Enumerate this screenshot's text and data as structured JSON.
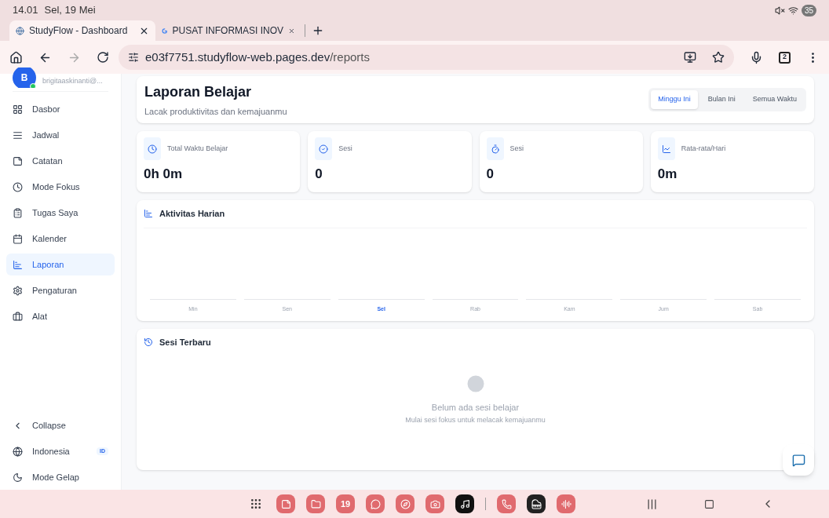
{
  "status_bar": {
    "time": "14.01",
    "date": "Sel, 19 Mei",
    "battery": "35"
  },
  "tabs": [
    {
      "title": "StudyFlow - Dashboard",
      "selected": true,
      "kind": "site"
    },
    {
      "title": "PUSAT INFORMASI INOV",
      "selected": false,
      "kind": "google"
    }
  ],
  "address_bar": {
    "url_host": "e03f7751.studyflow-web.pages.dev",
    "url_path": "/reports",
    "tab_count": "2"
  },
  "sidebar": {
    "avatar": "B",
    "email": "brigitaaskinanti@...",
    "online": true,
    "items": [
      {
        "label": "Dasbor",
        "selected": false
      },
      {
        "label": "Jadwal",
        "selected": false
      },
      {
        "label": "Catatan",
        "selected": false
      },
      {
        "label": "Mode Fokus",
        "selected": false
      },
      {
        "label": "Tugas Saya",
        "selected": false
      },
      {
        "label": "Kalender",
        "selected": false
      },
      {
        "label": "Laporan",
        "selected": true
      },
      {
        "label": "Pengaturan",
        "selected": false
      },
      {
        "label": "Alat",
        "selected": false
      }
    ],
    "footer": [
      {
        "label": "Collapse"
      },
      {
        "label": "Indonesia",
        "badge": "ID"
      },
      {
        "label": "Mode Gelap"
      }
    ]
  },
  "header": {
    "title": "Laporan Belajar",
    "subtitle": "Lacak produktivitas dan kemajuanmu",
    "periods": [
      {
        "label": "Minggu Ini",
        "selected": true
      },
      {
        "label": "Bulan Ini",
        "selected": false
      },
      {
        "label": "Semua Waktu",
        "selected": false
      }
    ]
  },
  "stats": [
    {
      "label": "Total Waktu Belajar",
      "value": "0h 0m"
    },
    {
      "label": "Sesi",
      "value": "0"
    },
    {
      "label": "Sesi",
      "value": "0"
    },
    {
      "label": "Rata-rata/Hari",
      "value": "0m"
    }
  ],
  "activity": {
    "title": "Aktivitas Harian",
    "days": [
      {
        "label": "Min",
        "selected": false
      },
      {
        "label": "Sen",
        "selected": false
      },
      {
        "label": "Sel",
        "selected": true
      },
      {
        "label": "Rab",
        "selected": false
      },
      {
        "label": "Kam",
        "selected": false
      },
      {
        "label": "Jum",
        "selected": false
      },
      {
        "label": "Sab",
        "selected": false
      }
    ]
  },
  "recent": {
    "title": "Sesi Terbaru",
    "empty_title": "Belum ada sesi belajar",
    "empty_hint": "Mulai sesi fokus untuk melacak kemajuanmu"
  },
  "dock": [
    {
      "kind": "notes"
    },
    {
      "kind": "folder"
    },
    {
      "kind": "calendar",
      "label": "19"
    },
    {
      "kind": "chat"
    },
    {
      "kind": "browser"
    },
    {
      "kind": "camera"
    },
    {
      "kind": "tiktok"
    },
    {
      "kind": "divider"
    },
    {
      "kind": "whatsapp"
    },
    {
      "kind": "piano"
    },
    {
      "kind": "recorder"
    }
  ]
}
